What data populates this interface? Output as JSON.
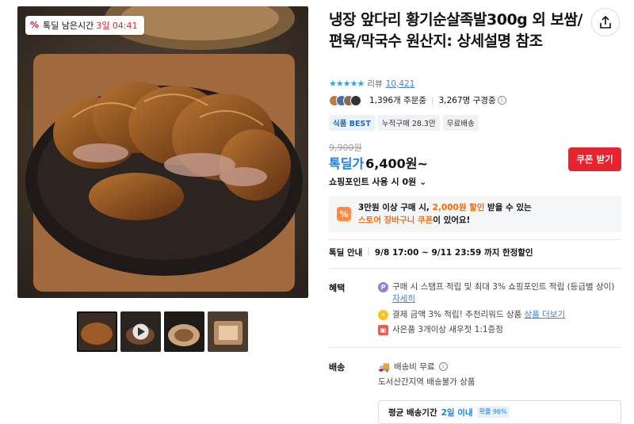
{
  "timer": {
    "label": "톡딜 남은시간",
    "remain": "3일 04:41"
  },
  "title": "냉장 앞다리 황기순살족발300g 외 보쌈/편육/막국수 원산지: 상세설명 참조",
  "rating": {
    "stars": "★★★★★",
    "review_label": "리뷰",
    "review_count": "10,421"
  },
  "buyers": {
    "orders": "1,396개 주문중",
    "subscribers": "3,267명 구경중"
  },
  "badges": [
    "식품 BEST",
    "누적구매 28.3만",
    "무료배송"
  ],
  "price": {
    "original": "9,900원",
    "label": "톡딜가",
    "value": "6,400원~",
    "coupon": "쿠폰 받기",
    "points": "쇼핑포인트 사용 시 0원"
  },
  "promo": {
    "line1_a": "3만원 이상 구매 시, ",
    "line1_b": "2,000원 할인",
    "line1_c": " 받을 수 있는",
    "line2_a": "스토어 장바구니 쿠폰",
    "line2_b": "이 있어요!"
  },
  "sale": {
    "label": "톡딜 안내",
    "period": "9/8 17:00 ~ 9/11 23:59 까지 한정할인"
  },
  "benefit": {
    "label": "혜택",
    "items": [
      {
        "text": "구매 시 스탬프 적립 및 최대 3% 쇼핑포인트 적립 (등급별 상이)",
        "link": "자세히"
      },
      {
        "text": "결제 금액 3% 적립! 추천리워드 상품",
        "link": "상품 더보기"
      },
      {
        "text": "사은품 3개이상 새우젓 1:1증정",
        "link": ""
      }
    ]
  },
  "shipping": {
    "label": "배송",
    "fee": "배송비 무료",
    "note": "도서산간지역 배송불가 상품",
    "avg_label": "평균 배송기간",
    "avg_value": "2일 이내",
    "avg_pill": "확률 96%"
  },
  "colors": {
    "accent": "#1a7ee8",
    "red": "#e8232f",
    "orange": "#ff6a00"
  }
}
